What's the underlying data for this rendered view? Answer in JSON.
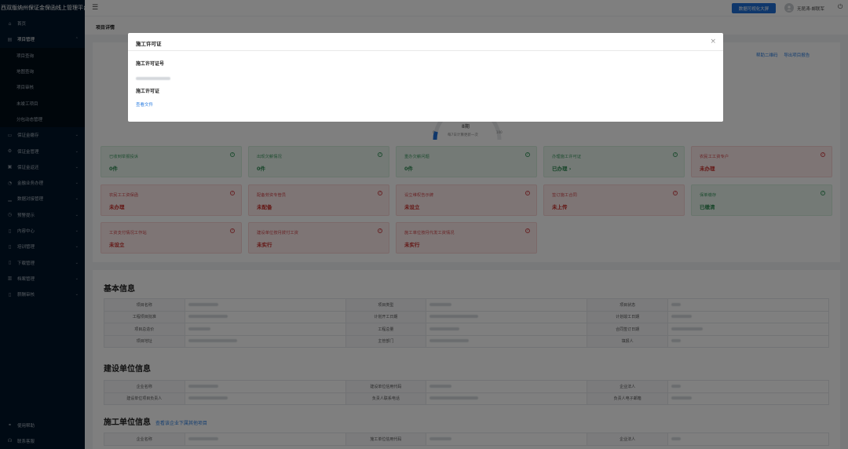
{
  "sidebar": {
    "brand": "西双版纳州保证金保函线上管理平台",
    "items": [
      {
        "label": "首页",
        "icon": "home-icon",
        "glyph": "⌂"
      },
      {
        "label": "项目管理",
        "icon": "calendar-icon",
        "glyph": "▤"
      },
      {
        "label": "项目查询"
      },
      {
        "label": "地图查询"
      },
      {
        "label": "项目审核"
      },
      {
        "label": "未竣工项目"
      },
      {
        "label": "分包动态管理"
      },
      {
        "label": "保证金缴存",
        "icon": "wallet-icon",
        "glyph": "▭"
      },
      {
        "label": "保证金管理",
        "icon": "settings-icon",
        "glyph": "⚙"
      },
      {
        "label": "保证金返还",
        "icon": "return-icon",
        "glyph": "▣"
      },
      {
        "label": "金融业务办理",
        "icon": "finance-icon",
        "glyph": "◔"
      },
      {
        "label": "数据对接管理",
        "icon": "data-icon",
        "glyph": "▁"
      },
      {
        "label": "预警提示",
        "icon": "clock-icon",
        "glyph": "◷"
      },
      {
        "label": "内容中心",
        "icon": "document-icon",
        "glyph": "▯"
      },
      {
        "label": "培训管理",
        "icon": "training-icon",
        "glyph": "▯"
      },
      {
        "label": "下载管理",
        "icon": "download-icon",
        "glyph": "▯"
      },
      {
        "label": "档案管理",
        "icon": "archive-icon",
        "glyph": "▥"
      },
      {
        "label": "薪酬审核",
        "icon": "bookmark-icon",
        "glyph": "▯"
      }
    ],
    "bottom": [
      {
        "label": "使用帮助",
        "icon": "link-icon",
        "glyph": "⚭"
      },
      {
        "label": "联系客服",
        "icon": "headset-icon",
        "glyph": "☊"
      }
    ]
  },
  "header": {
    "menu_icon": "☰",
    "big_screen_button": "数据可视化大屏",
    "user_name": "无昆涛-邮联军",
    "power_icon": "⏻"
  },
  "breadcrumb": "项目详情",
  "top_links": [
    "帮助二维码",
    "导出项目报告"
  ],
  "gauge": {
    "value_text": "8期",
    "caption": "每7日计算更新一次",
    "low": "0",
    "high": "100",
    "value_fraction": 0.08
  },
  "status_cards": [
    {
      "title": "已收到举报投诉",
      "value": "0件",
      "tone": "green"
    },
    {
      "title": "出现欠薪情况",
      "value": "0件",
      "tone": "green"
    },
    {
      "title": "重办欠薪问题",
      "value": "0件",
      "tone": "green"
    },
    {
      "title": "办理施工许可证",
      "value": "已办理 ›",
      "tone": "green"
    },
    {
      "title": "农民工工资专户",
      "value": "未办理",
      "tone": "red"
    },
    {
      "title": "农民工工资保函",
      "value": "未办理",
      "tone": "red"
    },
    {
      "title": "配备劳资专管员",
      "value": "未配备",
      "tone": "red"
    },
    {
      "title": "设立维权告示牌",
      "value": "未设立",
      "tone": "red"
    },
    {
      "title": "签订施工合同",
      "value": "未上传",
      "tone": "red"
    },
    {
      "title": "保单缴存",
      "value": "已缴清",
      "tone": "green"
    },
    {
      "title": "工资支付情况工作站",
      "value": "未设立",
      "tone": "red"
    },
    {
      "title": "建设单位按月拨付工资",
      "value": "未实行",
      "tone": "red"
    },
    {
      "title": "施工单位按月代发工资情况",
      "value": "未实行",
      "tone": "red"
    }
  ],
  "basic_info": {
    "title": "基本信息",
    "rows": [
      [
        "项目名称",
        "",
        "项目类型",
        "",
        "项目状态",
        ""
      ],
      [
        "工程项目批准",
        "",
        "计划开工日期",
        "",
        "计划竣工日期",
        ""
      ],
      [
        "项目总造价",
        "",
        "工程总量",
        "",
        "合同签订日期",
        ""
      ],
      [
        "项目地址",
        "",
        "主管部门",
        "",
        "填报人",
        ""
      ]
    ]
  },
  "builder_info": {
    "title": "建设单位信息",
    "rows": [
      [
        "企业名称",
        "",
        "建设单位信用代码",
        "",
        "企业法人",
        ""
      ],
      [
        "建设单位项目负责人",
        "",
        "负责人联系电话",
        "",
        "负责人电子邮箱",
        ""
      ]
    ]
  },
  "contractor_info": {
    "title": "施工单位信息",
    "link": "查看该企业下属其他项目",
    "rows": [
      [
        "企业名称",
        "",
        "施工单位信用代码",
        "",
        "企业法人",
        ""
      ]
    ]
  },
  "modal": {
    "title": "施工许可证",
    "close_icon": "×",
    "field1_label": "施工许可证号",
    "field2_label": "施工许可证",
    "view_file_link": "查看文件"
  }
}
